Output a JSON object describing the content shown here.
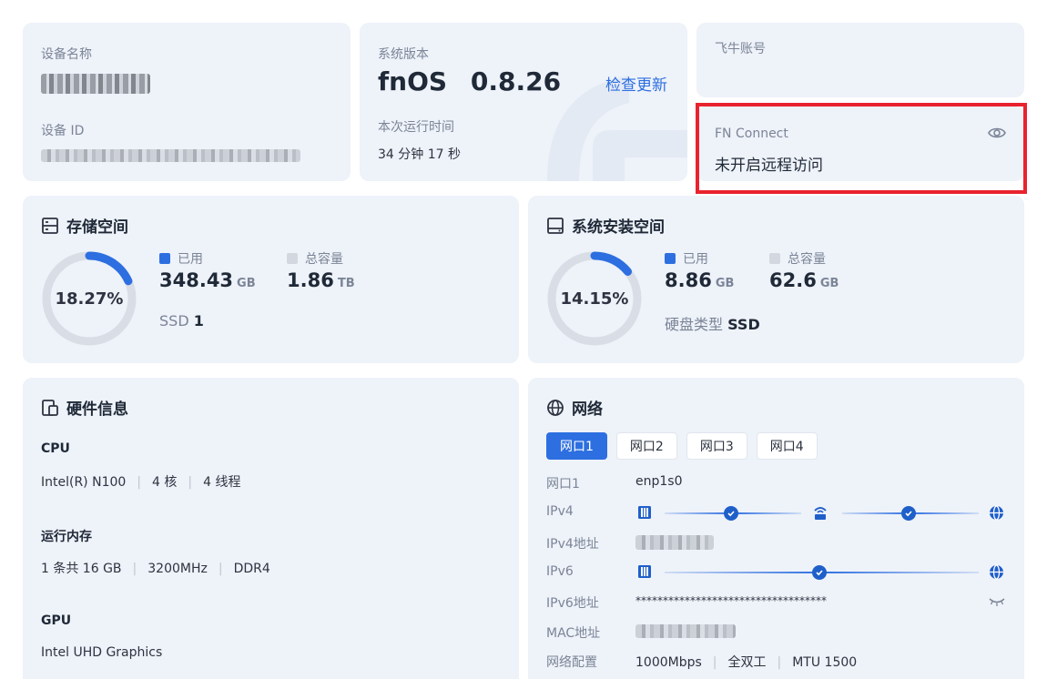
{
  "device": {
    "name_label": "设备名称",
    "id_label": "设备 ID"
  },
  "system": {
    "version_label": "系统版本",
    "os_name": "fnOS",
    "os_version": "0.8.26",
    "check_update": "检查更新",
    "uptime_label": "本次运行时间",
    "uptime_value": "34 分钟 17 秒"
  },
  "account": {
    "label": "飞牛账号"
  },
  "fn_connect": {
    "label": "FN Connect",
    "status": "未开启远程访问",
    "highlight_color": "#e8232f"
  },
  "storage": {
    "title": "存储空间",
    "percent_label": "18.27%",
    "percent": 18.27,
    "used_label": "已用",
    "used_value": "348.43",
    "used_unit": "GB",
    "total_label": "总容量",
    "total_value": "1.86",
    "total_unit": "TB",
    "disk_type": "SSD",
    "disk_count": "1"
  },
  "sys_space": {
    "title": "系统安装空间",
    "percent_label": "14.15%",
    "percent": 14.15,
    "used_label": "已用",
    "used_value": "8.86",
    "used_unit": "GB",
    "total_label": "总容量",
    "total_value": "62.6",
    "total_unit": "GB",
    "disk_type_label": "硬盘类型",
    "disk_type_value": "SSD"
  },
  "hardware": {
    "title": "硬件信息",
    "cpu_label": "CPU",
    "cpu_model": "Intel(R) N100",
    "cpu_cores": "4 核",
    "cpu_threads": "4 线程",
    "mem_label": "运行内存",
    "mem_count": "1 条共 16 GB",
    "mem_speed": "3200MHz",
    "mem_type": "DDR4",
    "gpu_label": "GPU",
    "gpu_model": "Intel UHD Graphics"
  },
  "network": {
    "title": "网络",
    "tabs": [
      "网口1",
      "网口2",
      "网口3",
      "网口4"
    ],
    "port_label": "网口1",
    "port_value": "enp1s0",
    "ipv4_label": "IPv4",
    "ipv4_addr_label": "IPv4地址",
    "ipv6_label": "IPv6",
    "ipv6_addr_label": "IPv6地址",
    "ipv6_addr_value": "***********************************",
    "mac_label": "MAC地址",
    "config_label": "网络配置",
    "speed": "1000Mbps",
    "duplex": "全双工",
    "mtu": "MTU 1500"
  },
  "colors": {
    "accent": "#2d6fe0",
    "card_bg": "#eef2f9",
    "ring_track": "#d9dde5"
  }
}
